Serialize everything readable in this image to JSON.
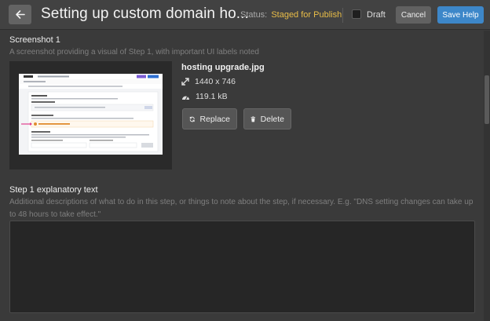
{
  "header": {
    "title": "Setting up custom domain ho...",
    "status_label": "Status:",
    "status_value": "Staged for Publish",
    "draft_label": "Draft",
    "cancel_label": "Cancel",
    "save_label": "Save Help",
    "save_color": "#3d87c9",
    "status_color": "#e9bd48"
  },
  "screenshot_section": {
    "title": "Screenshot 1",
    "description": "A screenshot providing a visual of Step 1, with important UI labels noted",
    "file": {
      "name": "hosting upgrade.jpg",
      "dimensions": "1440 x 746",
      "size": "119.1 kB"
    },
    "replace_label": "Replace",
    "delete_label": "Delete"
  },
  "step_section": {
    "title": "Step 1 explanatory text",
    "description": "Additional descriptions of what to do in this step, or things to note about the step, if necessary. E.g. \"DNS setting changes can take up to 48 hours to take effect.\"",
    "value": ""
  },
  "icons": {
    "back": "arrow-left-icon",
    "dimensions": "expand-icon",
    "size": "speedometer-icon",
    "replace": "refresh-icon",
    "delete": "trash-icon"
  }
}
